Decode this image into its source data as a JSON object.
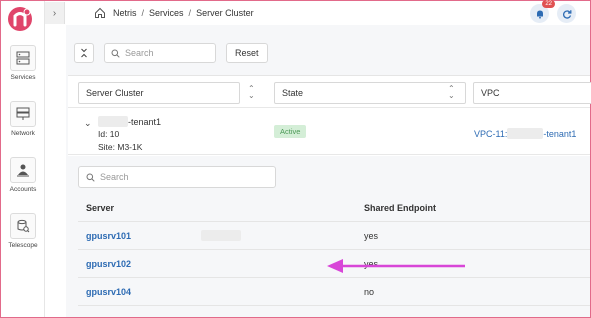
{
  "sidebar": {
    "items": [
      {
        "label": "Services",
        "icon": "server-icon"
      },
      {
        "label": "Network",
        "icon": "network-icon"
      },
      {
        "label": "Accounts",
        "icon": "account-icon"
      },
      {
        "label": "Telescope",
        "icon": "telescope-icon"
      }
    ]
  },
  "header": {
    "breadcrumb": [
      "Netris",
      "Services",
      "Server Cluster"
    ],
    "notification_count": "22"
  },
  "toolbar": {
    "search_placeholder": "Search",
    "reset_label": "Reset"
  },
  "filters": {
    "server_cluster": "Server Cluster",
    "state": "State",
    "vpc": "VPC"
  },
  "cluster": {
    "name_suffix": "-tenant1",
    "id_text": "Id: 10",
    "site_text": "Site: M3-1K",
    "status": "Active",
    "vpc_prefix": "VPC-11:",
    "vpc_suffix": "-tenant1"
  },
  "servers": {
    "search_placeholder": "Search",
    "columns": [
      "Server",
      "Shared Endpoint"
    ],
    "rows": [
      {
        "server": "gpusrv101",
        "shared_endpoint": "yes"
      },
      {
        "server": "gpusrv102",
        "shared_endpoint": "yes"
      },
      {
        "server": "gpusrv104",
        "shared_endpoint": "no"
      }
    ]
  },
  "colors": {
    "accent": "#2d6bb3",
    "brand": "#e0456a",
    "active_bg": "#d4eed7",
    "annotation_arrow": "#d846d8"
  }
}
